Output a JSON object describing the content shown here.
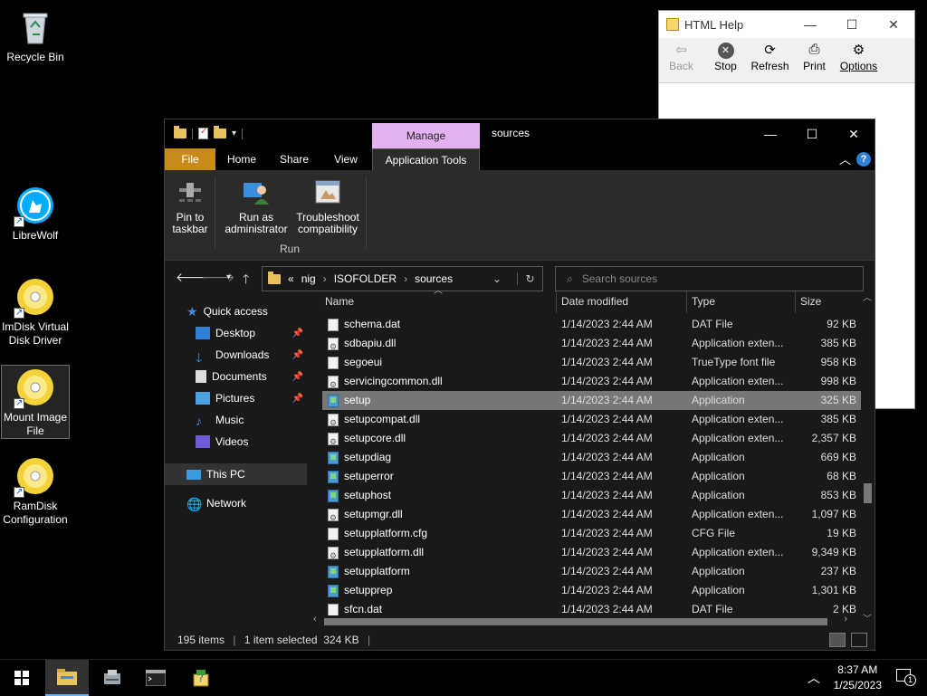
{
  "desktop": {
    "icons": [
      {
        "label": "Recycle Bin"
      },
      {
        "label": "LibreWolf"
      },
      {
        "label": "ImDisk Virtual Disk Driver"
      },
      {
        "label": "Mount Image File"
      },
      {
        "label": "RamDisk Configuration"
      }
    ]
  },
  "help_window": {
    "title": "HTML Help",
    "tools": [
      "Back",
      "Stop",
      "Refresh",
      "Print",
      "Options"
    ]
  },
  "explorer": {
    "context_tab": "Manage",
    "title": "sources",
    "ribbon_tabs": [
      "File",
      "Home",
      "Share",
      "View",
      "Application Tools"
    ],
    "ribbon_buttons": [
      {
        "label": "Pin to taskbar"
      },
      {
        "label": "Run as administrator"
      },
      {
        "label": "Troubleshoot compatibility"
      }
    ],
    "ribbon_group": "Run",
    "address": {
      "overflow": "«",
      "crumbs": [
        "nig",
        "ISOFOLDER",
        "sources"
      ]
    },
    "search_placeholder": "Search sources",
    "nav": [
      {
        "label": "Quick access",
        "pinned": false
      },
      {
        "label": "Desktop",
        "pinned": true
      },
      {
        "label": "Downloads",
        "pinned": true
      },
      {
        "label": "Documents",
        "pinned": true
      },
      {
        "label": "Pictures",
        "pinned": true
      },
      {
        "label": "Music",
        "pinned": false
      },
      {
        "label": "Videos",
        "pinned": false
      },
      {
        "label": "This PC",
        "pinned": false
      },
      {
        "label": "Network",
        "pinned": false
      }
    ],
    "columns": [
      "Name",
      "Date modified",
      "Type",
      "Size"
    ],
    "files": [
      {
        "name": "schema.dat",
        "date": "1/14/2023 2:44 AM",
        "type": "DAT File",
        "size": "92 KB",
        "icon": "doc"
      },
      {
        "name": "sdbapiu.dll",
        "date": "1/14/2023 2:44 AM",
        "type": "Application exten...",
        "size": "385 KB",
        "icon": "dll"
      },
      {
        "name": "segoeui",
        "date": "1/14/2023 2:44 AM",
        "type": "TrueType font file",
        "size": "958 KB",
        "icon": "doc"
      },
      {
        "name": "servicingcommon.dll",
        "date": "1/14/2023 2:44 AM",
        "type": "Application exten...",
        "size": "998 KB",
        "icon": "dll"
      },
      {
        "name": "setup",
        "date": "1/14/2023 2:44 AM",
        "type": "Application",
        "size": "325 KB",
        "icon": "exe",
        "selected": true
      },
      {
        "name": "setupcompat.dll",
        "date": "1/14/2023 2:44 AM",
        "type": "Application exten...",
        "size": "385 KB",
        "icon": "dll"
      },
      {
        "name": "setupcore.dll",
        "date": "1/14/2023 2:44 AM",
        "type": "Application exten...",
        "size": "2,357 KB",
        "icon": "dll"
      },
      {
        "name": "setupdiag",
        "date": "1/14/2023 2:44 AM",
        "type": "Application",
        "size": "669 KB",
        "icon": "exe"
      },
      {
        "name": "setuperror",
        "date": "1/14/2023 2:44 AM",
        "type": "Application",
        "size": "68 KB",
        "icon": "exe"
      },
      {
        "name": "setuphost",
        "date": "1/14/2023 2:44 AM",
        "type": "Application",
        "size": "853 KB",
        "icon": "exe"
      },
      {
        "name": "setupmgr.dll",
        "date": "1/14/2023 2:44 AM",
        "type": "Application exten...",
        "size": "1,097 KB",
        "icon": "dll"
      },
      {
        "name": "setupplatform.cfg",
        "date": "1/14/2023 2:44 AM",
        "type": "CFG File",
        "size": "19 KB",
        "icon": "doc"
      },
      {
        "name": "setupplatform.dll",
        "date": "1/14/2023 2:44 AM",
        "type": "Application exten...",
        "size": "9,349 KB",
        "icon": "dll"
      },
      {
        "name": "setupplatform",
        "date": "1/14/2023 2:44 AM",
        "type": "Application",
        "size": "237 KB",
        "icon": "exe"
      },
      {
        "name": "setupprep",
        "date": "1/14/2023 2:44 AM",
        "type": "Application",
        "size": "1,301 KB",
        "icon": "exe"
      },
      {
        "name": "sfcn.dat",
        "date": "1/14/2023 2:44 AM",
        "type": "DAT File",
        "size": "2 KB",
        "icon": "doc"
      }
    ],
    "status": {
      "items": "195 items",
      "selected": "1 item selected  324 KB"
    }
  },
  "taskbar": {
    "time": "8:37 AM",
    "date": "1/25/2023",
    "notification_count": "1"
  },
  "colors": {
    "file_tab": "#c78a1b",
    "manage_tab": "#e4b2f0",
    "selection": "#777777",
    "accent": "#6ab0f3"
  }
}
